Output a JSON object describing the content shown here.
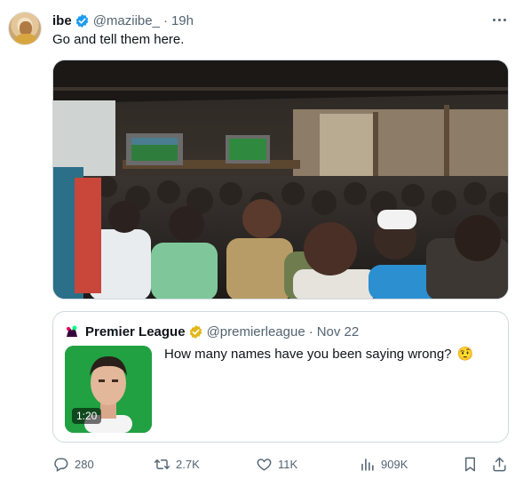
{
  "tweet": {
    "author_name": "ibe",
    "handle": "@maziibe_",
    "separator": "·",
    "time": "19h",
    "text": "Go and tell them here."
  },
  "quote": {
    "author_name": "Premier League",
    "handle": "@premierleague",
    "separator": "·",
    "date": "Nov 22",
    "text": "How many names have you been saying wrong?",
    "emoji": "🤨",
    "video_duration": "1:20"
  },
  "actions": {
    "replies": "280",
    "retweets": "2.7K",
    "likes": "11K",
    "views": "909K"
  },
  "colors": {
    "verified_blue": "#1d9bf0",
    "verified_gold": "#e2b719",
    "muted_text": "#536471",
    "border": "#cfd9de"
  },
  "icons": [
    "more-icon",
    "verified-badge-icon",
    "reply-icon",
    "retweet-icon",
    "like-icon",
    "views-icon",
    "bookmark-icon",
    "share-icon"
  ]
}
